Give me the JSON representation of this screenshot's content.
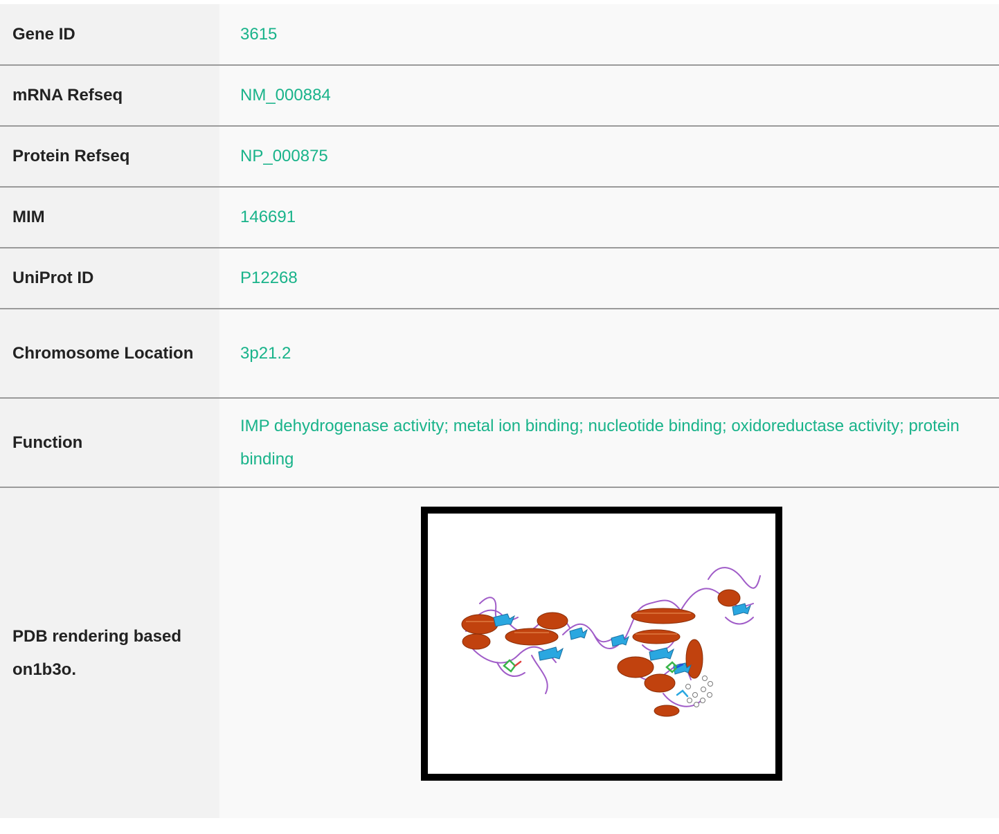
{
  "rows": [
    {
      "label": "Gene ID",
      "value": "3615"
    },
    {
      "label": "mRNA Refseq",
      "value": "NM_000884"
    },
    {
      "label": "Protein Refseq",
      "value": "NP_000875"
    },
    {
      "label": "MIM",
      "value": "146691"
    },
    {
      "label": "UniProt ID",
      "value": "P12268"
    },
    {
      "label": "Chromosome Location",
      "value": "3p21.2"
    },
    {
      "label": "Function",
      "value": "IMP dehydrogenase activity; metal ion binding; nucleotide binding; oxidoreductase activity; protein binding"
    }
  ],
  "pdb_row": {
    "label": "PDB rendering based on1b3o."
  },
  "colors": {
    "link": "#19b38a",
    "label_bg": "#f2f2f2",
    "value_bg": "#f9f9f9",
    "row_border": "#9a9a9a",
    "helix": "#c1420e",
    "sheet": "#2aa7e0",
    "coil": "#a05cc8"
  }
}
